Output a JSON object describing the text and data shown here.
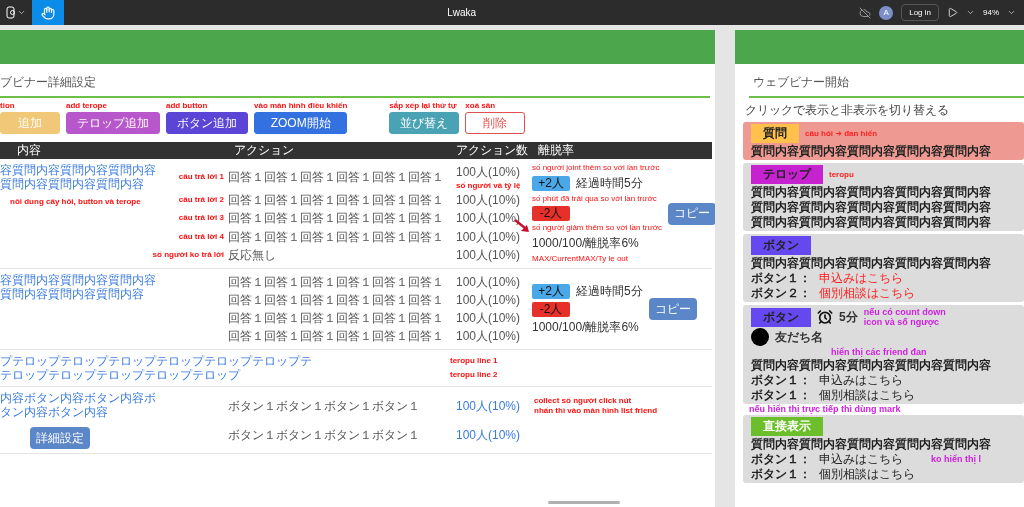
{
  "toolbar": {
    "title": "Lwaka",
    "avatar": "A",
    "login": "Log in",
    "zoom": "94%"
  },
  "detail_frame": {
    "title": "ブビナー詳細設定",
    "buttons": [
      {
        "label": "追加",
        "note": "tion",
        "color": "#f0c878",
        "kind": "filled"
      },
      {
        "label": "テロップ追加",
        "note": "add terope",
        "color": "#b856cc",
        "kind": "filled"
      },
      {
        "label": "ボタン追加",
        "note": "add button",
        "color": "#5b45d6",
        "kind": "filled"
      },
      {
        "label": "ZOOM開始",
        "note": "vào màn hình điều khiển",
        "color": "#3370e0",
        "kind": "filled"
      }
    ],
    "edit_buttons": [
      {
        "label": "並び替え",
        "note": "sắp xếp lại thứ tự",
        "color": "#4aa3b5",
        "kind": "filled"
      },
      {
        "label": "削除",
        "note": "xoá sản",
        "color": "#e05050",
        "kind": "outline"
      }
    ],
    "table": {
      "columns": [
        "内容",
        "アクション",
        "アクション数",
        "離脱率"
      ],
      "sections": [
        {
          "kind": "question",
          "content": "容質問内容質問内容質問内容質問内容質問内容質問内容",
          "content_note": "nôi dung  cây hỏi, button và terope",
          "answers": [
            {
              "text": "回答１回答１回答１回答１回答１回答１",
              "count": "100人(10%)",
              "note": "câu trả lời 1",
              "count_note": "số người và tỷ lệ"
            },
            {
              "text": "回答１回答１回答１回答１回答１回答１",
              "count": "100人(10%)",
              "note": "câu trả lời 2"
            },
            {
              "text": "回答１回答１回答１回答１回答１回答１",
              "count": "100人(10%)",
              "note": "câu trả lời 3"
            },
            {
              "text": "回答１回答１回答１回答１回答１回答１",
              "count": "100人(10%)",
              "note": "câu trả lời 4"
            },
            {
              "text": "反応無し",
              "count": "100人(10%)",
              "note": "số người ko trả lời"
            }
          ],
          "stats": {
            "increase": "+2人",
            "elapsed": "経過時間5分",
            "decrease": "-2人",
            "summary": "1000/100/離脱率6%",
            "copy": "コピー",
            "pointer_arrow": true,
            "notes": {
              "increase": "số người joint thêm so với lần trước",
              "elapsed": "số phút đã trải qua so với lần trước",
              "decrease": "số người giảm thêm so với lần trước",
              "summary": "MAX/CurrentMAX/Ty le out"
            }
          }
        },
        {
          "kind": "question",
          "content": "容質問内容質問内容質問内容質問内容質問内容質問内容",
          "answers": [
            {
              "text": "回答１回答１回答１回答１回答１回答１",
              "count": "100人(10%)"
            },
            {
              "text": "回答１回答１回答１回答１回答１回答１",
              "count": "100人(10%)"
            },
            {
              "text": "回答１回答１回答１回答１回答１回答１",
              "count": "100人(10%)"
            },
            {
              "text": "回答１回答１回答１回答１回答１回答１",
              "count": "100人(10%)"
            }
          ],
          "stats": {
            "increase": "+2人",
            "elapsed": "経過時間5分",
            "decrease": "-2人",
            "summary": "1000/100/離脱率6%",
            "copy": "コピー",
            "pointer_arrow": false
          }
        },
        {
          "kind": "telop",
          "lines": [
            {
              "text": "プテロップテロップテロップテロップテロップテロップテ",
              "note": "teropu line 1"
            },
            {
              "text": "テロップテロップテロップテロップテロップ",
              "note": "teropu line 2"
            }
          ]
        },
        {
          "kind": "button",
          "content": "内容ボタン内容ボタン内容ボタン内容ボタン内容",
          "detail_button": "詳細設定",
          "answers": [
            {
              "text": "ボタン１ボタン１ボタン１ボタン１",
              "count": "100人(10%)"
            },
            {
              "text": "ボタン１ボタン１ボタン１ボタン１",
              "count": "100人(10%)"
            }
          ],
          "notes": [
            "collect số người click nút",
            "nhấn thì vào màn hình list friend"
          ]
        }
      ]
    }
  },
  "webinar_frame": {
    "title": "ウェブビナー開始",
    "caption": "クリックで表示と非表示を切り替える",
    "cards": [
      {
        "tag": "質問",
        "color": "#ffc04c",
        "active": true,
        "note": {
          "text": "câu hỏi ➜ đan hiển",
          "color": "#ff2020"
        },
        "lines": [
          "質問内容質問内容質問内容質問内容質問内容"
        ]
      },
      {
        "tag": "テロップ",
        "color": "#c722d0",
        "active": false,
        "note": {
          "text": "teropu",
          "color": "#ff2020"
        },
        "lines": [
          "質問内容質問内容質問内容質問内容質問内容",
          "質問内容質問内容質問内容質問内容質問内容",
          "質問内容質問内容質問内容質問内容質問内容"
        ]
      },
      {
        "tag": "ボタン",
        "color": "#6648f0",
        "active": false,
        "lines": [
          "質問内容質問内容質問内容質問内容質問内容"
        ],
        "buttons": [
          {
            "label": "ボタン１：",
            "value": "申込みはこちら",
            "emphasized": true
          },
          {
            "label": "ボタン２：",
            "value": "個別相談はこちら",
            "emphasized": true
          }
        ]
      },
      {
        "tag": "ボタン",
        "color": "#6648f0",
        "active": false,
        "timer": "5分",
        "timer_notes": [
          {
            "text": "nếu có count down",
            "color": "#d020e0"
          },
          {
            "text": "icon và số  ngược",
            "color": "#d020e0"
          }
        ],
        "friends": [
          {
            "name": "友だち名"
          }
        ],
        "friends_note": {
          "text": "hiển thị các friend đan",
          "color": "#d020e0"
        },
        "lines": [
          "質問内容質問内容質問内容質問内容質問内容"
        ],
        "buttons": [
          {
            "label": "ボタン１：",
            "value": "申込みはこちら",
            "emphasized": false
          },
          {
            "label": "ボタン１：",
            "value": "個別相談はこちら",
            "emphasized": false
          }
        ],
        "after_note": {
          "text": "nếu hiển thị trực tiếp thì dùng mark",
          "color": "#d020e0"
        }
      },
      {
        "tag": "直接表示",
        "color": "#6cbf2a",
        "active": false,
        "lines": [
          "質問内容質問内容質問内容質問内容質問内容"
        ],
        "buttons": [
          {
            "label": "ボタン１：",
            "value": "申込みはこちら",
            "emphasized": false
          },
          {
            "label": "ボタン１：",
            "value": "個別相談はこちら",
            "emphasized": false
          }
        ],
        "buttons_note": {
          "text": "ko hiển thị l",
          "color": "#d020e0"
        }
      }
    ]
  }
}
